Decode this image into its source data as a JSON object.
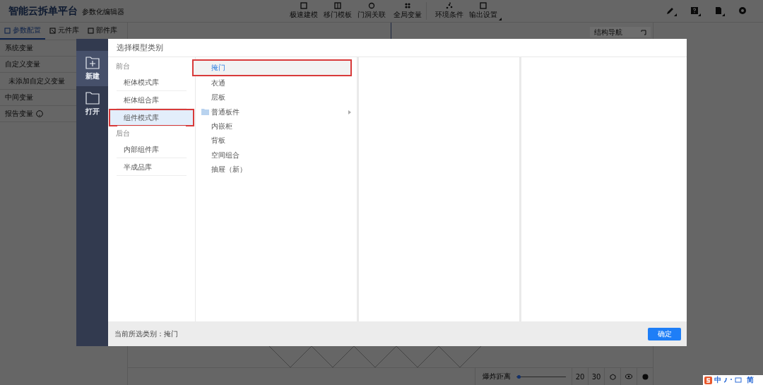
{
  "app": {
    "title": "智能云拆单平台",
    "subtitle": "参数化编辑器",
    "toolbar": [
      {
        "label": "极速建模",
        "has_menu": false
      },
      {
        "label": "移门模板",
        "has_menu": false
      },
      {
        "label": "门洞关联",
        "has_menu": false
      },
      {
        "label": "全局变量",
        "has_menu": false
      },
      {
        "label": "环境条件",
        "has_menu": false
      },
      {
        "label": "输出设置",
        "has_menu": true
      }
    ],
    "right_tools": [
      {
        "kind": "pencil",
        "has_menu": true
      },
      {
        "kind": "help",
        "has_menu": true
      },
      {
        "kind": "file",
        "has_menu": true
      },
      {
        "kind": "settings",
        "has_menu": false
      }
    ],
    "panel_tabs": [
      {
        "label": "参数配置",
        "selected": true
      },
      {
        "label": "元件库",
        "selected": false
      },
      {
        "label": "部件库",
        "selected": false
      }
    ],
    "variables": [
      {
        "label": "系统变量",
        "kind": "group",
        "help": false
      },
      {
        "label": "自定义变量",
        "kind": "group",
        "help": false
      },
      {
        "label": "未添加自定义变量",
        "kind": "empty",
        "help": false
      },
      {
        "label": "中间变量",
        "kind": "group",
        "help": false
      },
      {
        "label": "报告变量",
        "kind": "group",
        "help": true
      }
    ],
    "nav_panel": {
      "title": "结构导航"
    },
    "bottom_bar": {
      "label": "爆炸距离",
      "level": 0.04,
      "values": [
        "20",
        "30"
      ]
    }
  },
  "modal": {
    "nav": [
      {
        "label": "新建",
        "kind": "new",
        "selected": true
      },
      {
        "label": "打开",
        "kind": "open",
        "selected": false
      }
    ],
    "title": "选择模型类别",
    "sections": [
      {
        "heading": "前台",
        "items": [
          {
            "label": "柜体模式库",
            "selected": false
          },
          {
            "label": "柜体组合库",
            "selected": false
          },
          {
            "label": "组件模式库",
            "selected": true
          }
        ]
      },
      {
        "heading": "后台",
        "items": [
          {
            "label": "内部组件库",
            "selected": false
          },
          {
            "label": "半成品库",
            "selected": false
          }
        ]
      }
    ],
    "categories": [
      {
        "label": "掩门",
        "folder": false,
        "has_children": false,
        "selected": true
      },
      {
        "label": "衣通",
        "folder": false,
        "has_children": false,
        "selected": false
      },
      {
        "label": "层板",
        "folder": false,
        "has_children": false,
        "selected": false
      },
      {
        "label": "普通板件",
        "folder": true,
        "has_children": true,
        "selected": false
      },
      {
        "label": "内嵌柜",
        "folder": false,
        "has_children": false,
        "selected": false
      },
      {
        "label": "背板",
        "folder": false,
        "has_children": false,
        "selected": false
      },
      {
        "label": "空间组合",
        "folder": false,
        "has_children": false,
        "selected": false
      },
      {
        "label": "抽屉（新）",
        "folder": false,
        "has_children": false,
        "selected": false
      }
    ],
    "status": "当前所选类别：掩门",
    "confirm": "确定"
  },
  "ime": {
    "labels": [
      "中",
      "简"
    ]
  }
}
